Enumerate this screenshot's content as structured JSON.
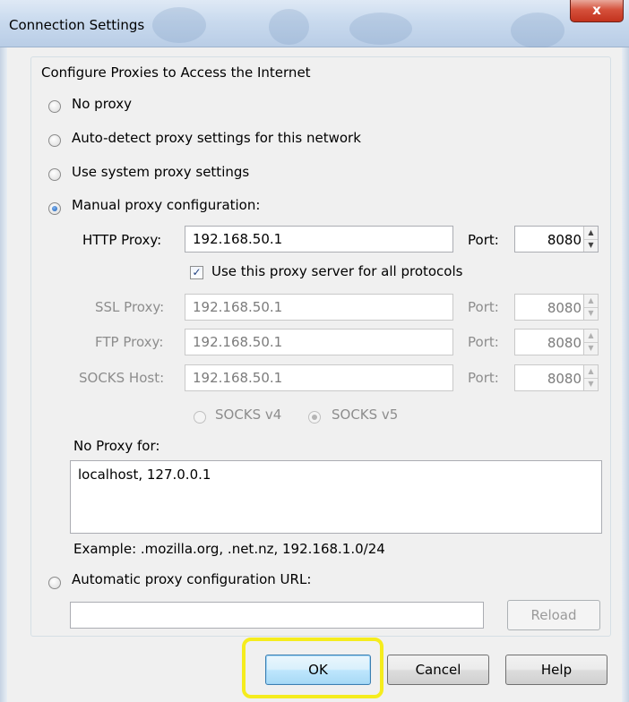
{
  "window": {
    "title": "Connection Settings",
    "close_label": "x"
  },
  "group": {
    "legend": "Configure Proxies to Access the Internet"
  },
  "proxy_options": {
    "no_proxy": "No proxy",
    "auto_detect": "Auto-detect proxy settings for this network",
    "system": "Use system proxy settings",
    "manual": "Manual proxy configuration:",
    "auto_url": "Automatic proxy configuration URL:",
    "selected": "manual"
  },
  "manual": {
    "http_label": "HTTP Proxy:",
    "http_value": "192.168.50.1",
    "port_label": "Port:",
    "http_port": "8080",
    "use_for_all_label": "Use this proxy server for all protocols",
    "use_for_all_checked": true,
    "ssl_label": "SSL Proxy:",
    "ssl_value": "192.168.50.1",
    "ssl_port": "8080",
    "ftp_label": "FTP Proxy:",
    "ftp_value": "192.168.50.1",
    "ftp_port": "8080",
    "socks_label": "SOCKS Host:",
    "socks_value": "192.168.50.1",
    "socks_port": "8080",
    "socks_v4": "SOCKS v4",
    "socks_v5": "SOCKS v5",
    "socks_selected": "v5"
  },
  "no_proxy": {
    "label": "No Proxy for:",
    "value": "localhost, 127.0.0.1",
    "example": "Example: .mozilla.org, .net.nz, 192.168.1.0/24"
  },
  "auto_config": {
    "url_value": "",
    "reload_label": "Reload"
  },
  "buttons": {
    "ok": "OK",
    "cancel": "Cancel",
    "help": "Help"
  },
  "colors": {
    "highlight": "#f5ec1d",
    "close_button": "#c3321d",
    "titlebar": "#c9daee"
  }
}
